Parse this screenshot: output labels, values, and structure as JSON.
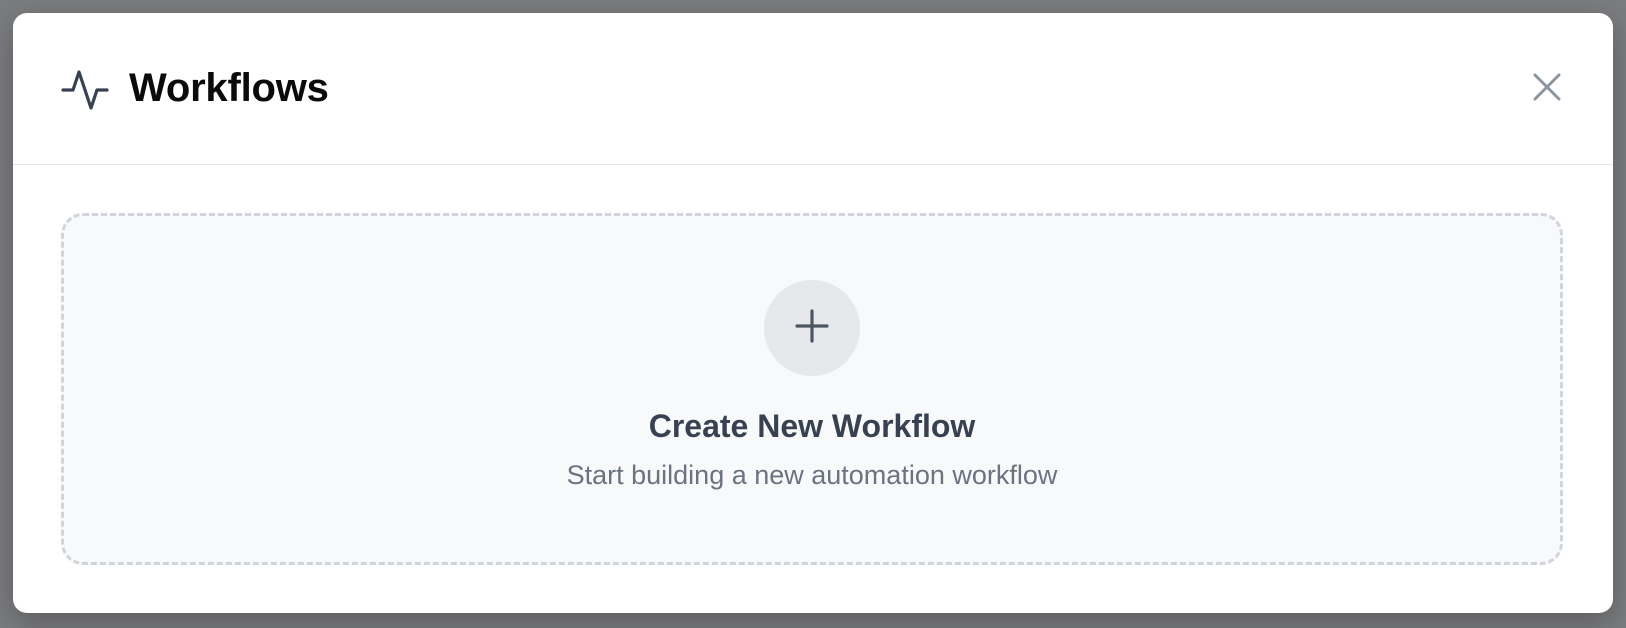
{
  "modal": {
    "title": "Workflows",
    "title_icon": "activity-pulse-icon",
    "close_icon": "close-icon"
  },
  "create_card": {
    "icon": "plus-icon",
    "title": "Create New Workflow",
    "subtitle": "Start building a new automation workflow"
  },
  "colors": {
    "backdrop": "#7b7c7e",
    "modal_bg": "#ffffff",
    "card_bg": "#f8f9fb",
    "card_border": "#d1d5db",
    "plus_circle_bg": "#e7e8eb",
    "title_text": "#0b0b0c",
    "card_title_text": "#374151",
    "card_subtitle_text": "#6b7280",
    "icon_stroke": "#374151",
    "close_icon_stroke": "#8b95a1"
  }
}
